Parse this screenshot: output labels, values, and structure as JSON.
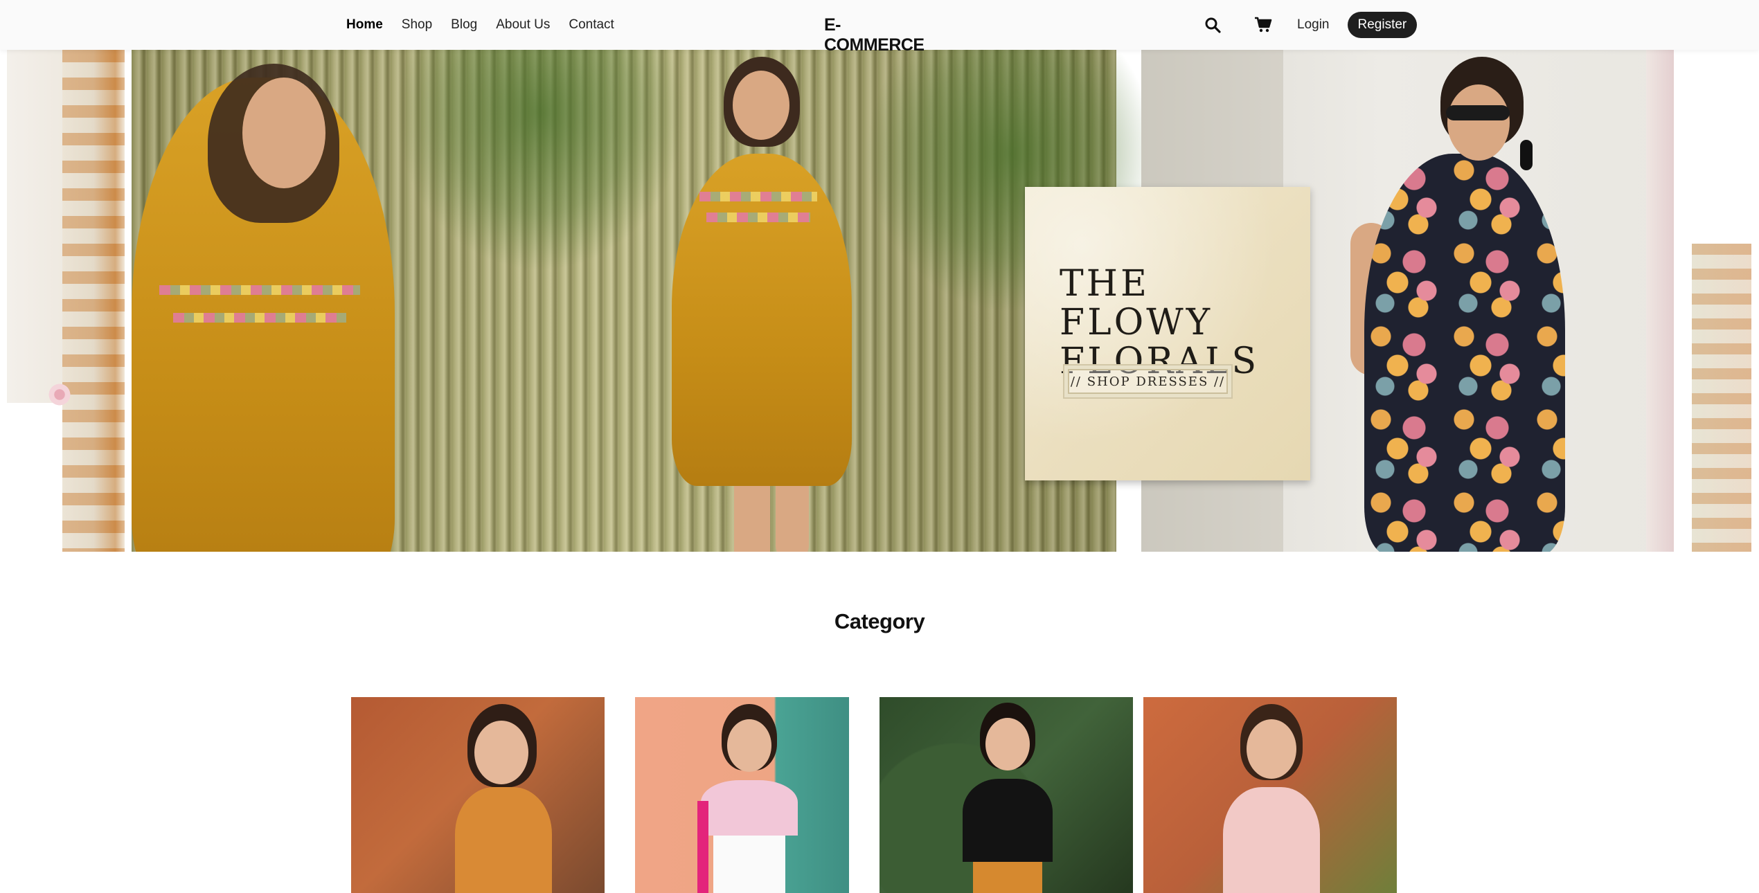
{
  "header": {
    "nav": [
      {
        "label": "Home",
        "active": true
      },
      {
        "label": "Shop",
        "active": false
      },
      {
        "label": "Blog",
        "active": false
      },
      {
        "label": "About Us",
        "active": false
      },
      {
        "label": "Contact",
        "active": false
      }
    ],
    "brand": "E-COMMERCE",
    "icons": {
      "search": "search-icon",
      "cart": "cart-icon"
    },
    "login_label": "Login",
    "register_label": "Register"
  },
  "hero": {
    "promo_title_line1": "THE FLOWY",
    "promo_title_line2": "FLORALS",
    "cta_label": "// SHOP DRESSES //"
  },
  "category_section": {
    "title": "Category",
    "items": [
      {
        "image": "category-photo-orange-dress"
      },
      {
        "image": "category-photo-pink-top"
      },
      {
        "image": "category-photo-black-top"
      },
      {
        "image": "category-photo-pink-dress"
      }
    ]
  },
  "colors": {
    "header_bg": "#fafafa",
    "register_bg": "#1f1f1f",
    "text": "#111111"
  }
}
